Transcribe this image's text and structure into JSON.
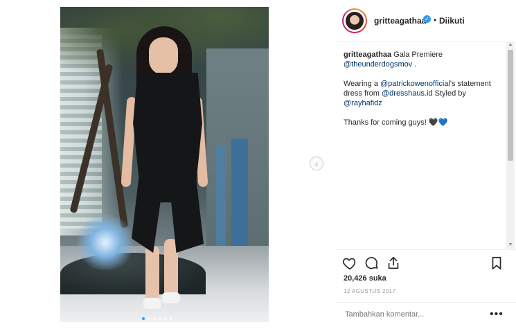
{
  "post": {
    "username": "gritteagathaa",
    "follow_status": "Diikuti",
    "separator": "•",
    "caption_user": "gritteagathaa",
    "caption_line1_text": " Gala Premiere",
    "mention_underdogs": "@theunderdogsmov",
    "mention_underdogs_suffix": " .",
    "wearing_prefix": "Wearing a ",
    "mention_patrick": "@patrickowenofficial",
    "wearing_suffix": "'s statement dress from ",
    "mention_dresshaus": "@dresshaus.id",
    "styled_text": " Styled by ",
    "mention_rayha": "@rayhafidz",
    "thanks_text": "Thanks for coming guys! ",
    "heart_black": "🖤",
    "heart_blue": "💙",
    "likes": "20,426 suka",
    "date": "12 AGUSTUS 2017",
    "comment_placeholder": "Tambahkan komentar...",
    "more_glyph": "•••"
  },
  "icons": {
    "verified": "verified-badge-icon",
    "next": "chevron-right-icon",
    "like": "heart-outline-icon",
    "comment": "comment-bubble-icon",
    "share": "share-icon",
    "save": "bookmark-icon"
  },
  "colors": {
    "verified_blue": "#3897f0",
    "mention_blue": "#003569",
    "text": "#262626",
    "muted": "#999999"
  },
  "carousel": {
    "current": 1,
    "total": 6
  }
}
